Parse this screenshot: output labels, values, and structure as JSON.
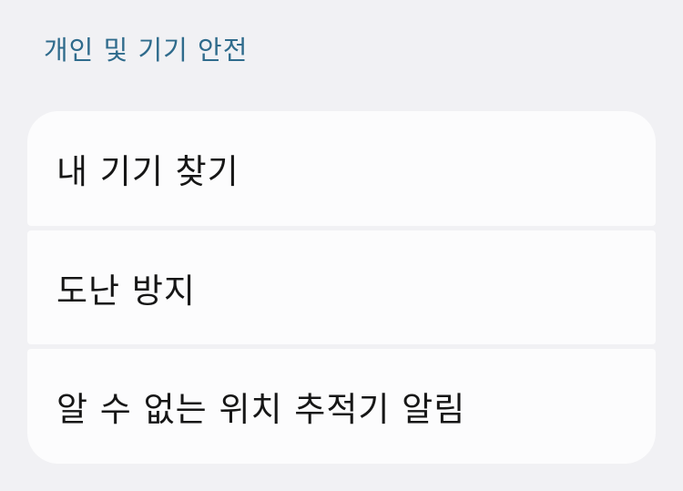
{
  "section": {
    "title": "개인 및 기기 안전"
  },
  "items": [
    {
      "label": "내 기기 찾기"
    },
    {
      "label": "도난 방지"
    },
    {
      "label": "알 수 없는 위치 추적기 알림"
    }
  ]
}
